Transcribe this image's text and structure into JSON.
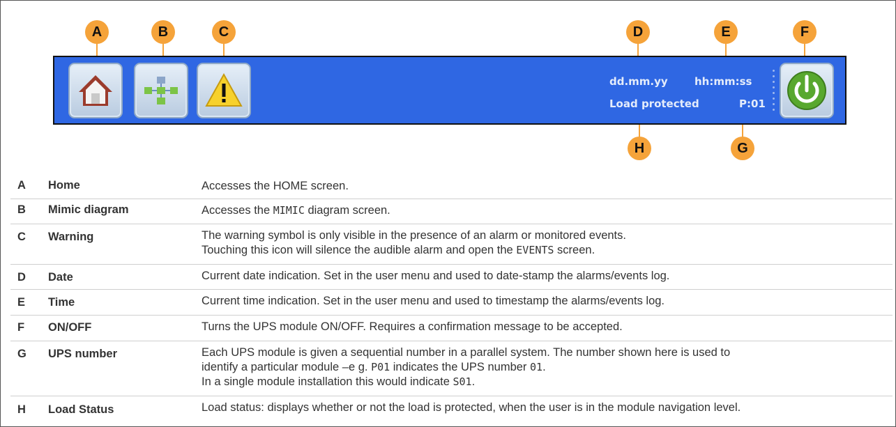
{
  "statusbar": {
    "date": "dd.mm.yy",
    "time": "hh:mm:ss",
    "load_status": "Load protected",
    "ups_number": "P:01"
  },
  "callouts": [
    "A",
    "B",
    "C",
    "D",
    "E",
    "F",
    "G",
    "H"
  ],
  "colors": {
    "bar_blue": "#2f67e3",
    "callout": "#f5a33a",
    "power_green": "#58a82e"
  },
  "icons": {
    "A": "home-icon",
    "B": "mimic-diagram-icon",
    "C": "warning-icon",
    "F": "power-icon"
  },
  "legend": [
    {
      "letter": "A",
      "name": "Home",
      "desc": [
        "Accesses the HOME screen."
      ]
    },
    {
      "letter": "B",
      "name": "Mimic diagram",
      "desc_pre": "Accesses the ",
      "desc_mono": "MIMIC",
      "desc_post": " diagram screen."
    },
    {
      "letter": "C",
      "name": "Warning",
      "line1": "The warning symbol is only visible in the presence of an alarm or monitored events.",
      "line2_pre": "Touching this icon will silence the audible alarm and open the ",
      "line2_mono": "EVENTS",
      "line2_post": " screen."
    },
    {
      "letter": "D",
      "name": "Date",
      "desc": [
        "Current date indication. Set in the user menu and used to date-stamp the alarms/events log."
      ]
    },
    {
      "letter": "E",
      "name": "Time",
      "desc": [
        "Current time indication. Set in the user menu and used to timestamp the alarms/events log."
      ]
    },
    {
      "letter": "F",
      "name": "ON/OFF",
      "desc": [
        "Turns the UPS module ON/OFF. Requires a confirmation message to be accepted."
      ]
    },
    {
      "letter": "G",
      "name": "UPS number",
      "line1": "Each UPS module is given a sequential number in a parallel system. The number shown here is used to",
      "line2_pre": "identify a particular module –e g. ",
      "line2_mono": "P01",
      "line2_mid": " indicates the UPS number ",
      "line2_mono2": "01",
      "line2_post": ".",
      "line3_pre": "In a single module installation this would indicate ",
      "line3_mono": "S01",
      "line3_post": "."
    },
    {
      "letter": "H",
      "name": "Load Status",
      "desc": [
        "Load status: displays whether or not the load is protected, when the user is in the module navigation level."
      ]
    }
  ]
}
